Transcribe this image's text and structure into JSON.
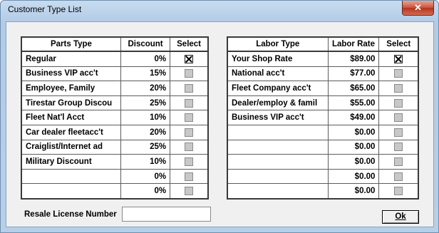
{
  "window": {
    "title": "Customer Type List",
    "close_glyph": "✕"
  },
  "parts": {
    "headers": [
      "Parts Type",
      "Discount",
      "Select"
    ],
    "rows": [
      {
        "type": "Regular",
        "discount": "0%",
        "selected": true
      },
      {
        "type": "Business VIP acc't",
        "discount": "15%",
        "selected": false
      },
      {
        "type": "Employee, Family",
        "discount": "20%",
        "selected": false
      },
      {
        "type": "Tirestar Group Discou",
        "discount": "25%",
        "selected": false
      },
      {
        "type": "Fleet Nat'l Acct",
        "discount": "10%",
        "selected": false
      },
      {
        "type": "Car dealer fleetacc't",
        "discount": "20%",
        "selected": false
      },
      {
        "type": "Craiglist/Internet ad",
        "discount": "25%",
        "selected": false
      },
      {
        "type": "Military Discount",
        "discount": "10%",
        "selected": false
      },
      {
        "type": "",
        "discount": "0%",
        "selected": false
      },
      {
        "type": "",
        "discount": "0%",
        "selected": false
      }
    ]
  },
  "labor": {
    "headers": [
      "Labor Type",
      "Labor Rate",
      "Select"
    ],
    "rows": [
      {
        "type": "Your Shop Rate",
        "rate": "$89.00",
        "selected": true
      },
      {
        "type": "National acc't",
        "rate": "$77.00",
        "selected": false
      },
      {
        "type": "Fleet Company acc't",
        "rate": "$65.00",
        "selected": false
      },
      {
        "type": "Dealer/employ & famil",
        "rate": "$55.00",
        "selected": false
      },
      {
        "type": "Business VIP acc't",
        "rate": "$49.00",
        "selected": false
      },
      {
        "type": "",
        "rate": "$0.00",
        "selected": false
      },
      {
        "type": "",
        "rate": "$0.00",
        "selected": false
      },
      {
        "type": "",
        "rate": "$0.00",
        "selected": false
      },
      {
        "type": "",
        "rate": "$0.00",
        "selected": false
      },
      {
        "type": "",
        "rate": "$0.00",
        "selected": false
      }
    ]
  },
  "resale": {
    "label": "Resale License Number",
    "value": ""
  },
  "ok_button": {
    "label": "Ok"
  }
}
